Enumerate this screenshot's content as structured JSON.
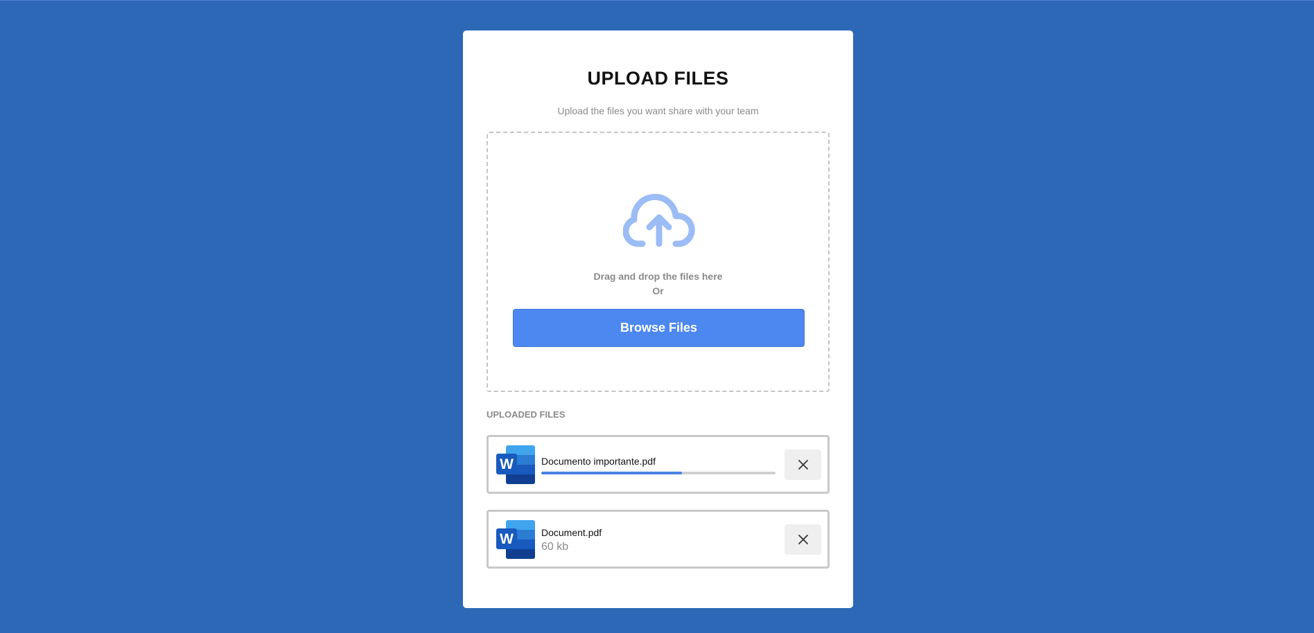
{
  "header": {
    "title": "UPLOAD FILES",
    "subtitle": "Upload the files you want share with your team"
  },
  "dropzone": {
    "icon": "cloud-upload-icon",
    "drag_text": "Drag and drop the files here",
    "or_text": "Or",
    "browse_label": "Browse Files"
  },
  "uploaded": {
    "label": "UPLOADED FILES",
    "files": [
      {
        "name": "Documento importante.pdf",
        "icon": "word-document-icon",
        "progress": 0.6,
        "status": "uploading"
      },
      {
        "name": "Document.pdf",
        "icon": "word-document-icon",
        "size": "60 kb",
        "status": "done"
      }
    ]
  },
  "colors": {
    "background": "#2c68b6",
    "accent": "#4d88f0",
    "cloud": "#9bbcf5"
  }
}
